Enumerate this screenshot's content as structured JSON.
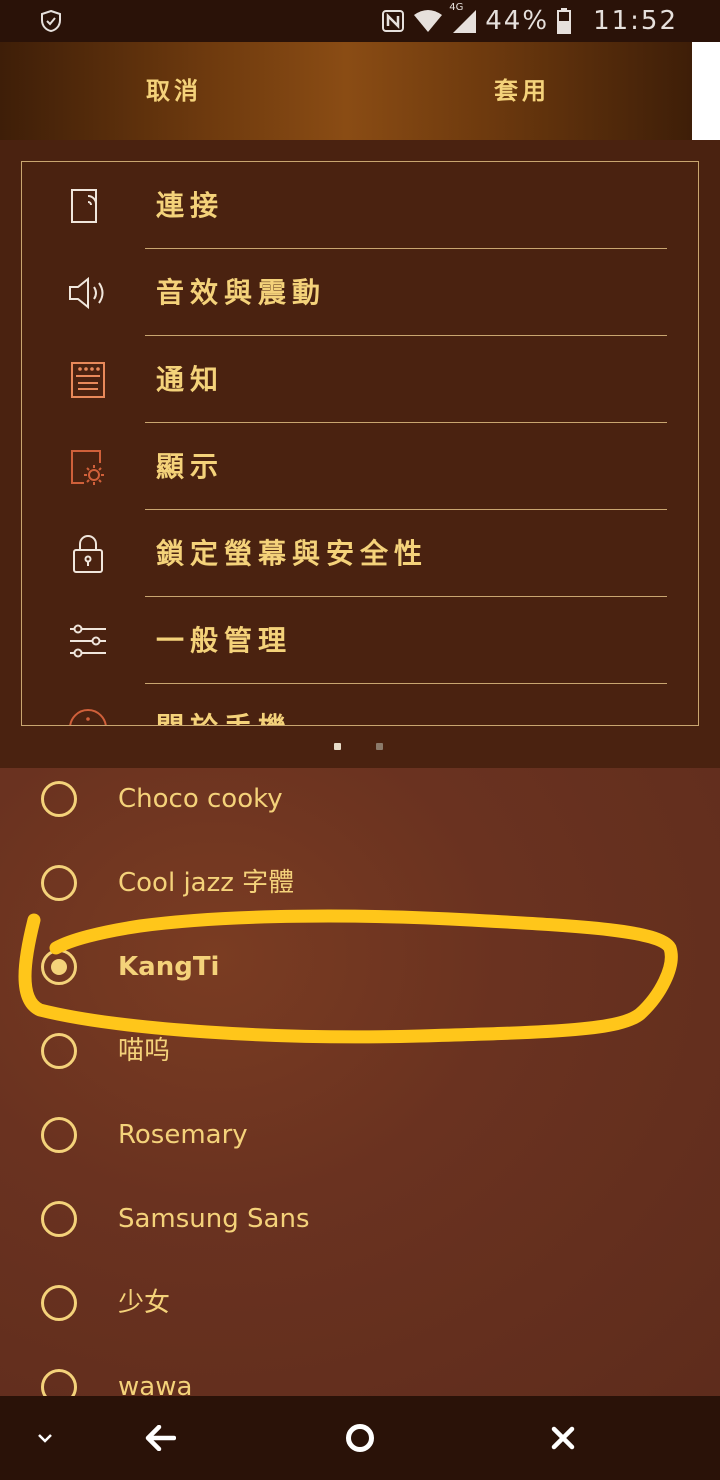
{
  "status_bar": {
    "battery": "44%",
    "time": "11:52",
    "network": "4G",
    "icons": [
      "shield-icon",
      "nfc-icon",
      "wifi-icon",
      "signal-icon",
      "battery-icon"
    ]
  },
  "action_bar": {
    "cancel_label": "取消",
    "apply_label": "套用"
  },
  "preview_menu": {
    "items": [
      {
        "label": "連接",
        "icon": "connections-icon"
      },
      {
        "label": "音效與震動",
        "icon": "speaker-icon"
      },
      {
        "label": "通知",
        "icon": "notifications-icon"
      },
      {
        "label": "顯示",
        "icon": "display-brightness-icon"
      },
      {
        "label": "鎖定螢幕與安全性",
        "icon": "lock-icon"
      },
      {
        "label": "一般管理",
        "icon": "sliders-icon"
      },
      {
        "label": "關於手機",
        "icon": "info-icon"
      }
    ]
  },
  "font_list": {
    "items": [
      {
        "label": "Choco cooky",
        "selected": false
      },
      {
        "label": "Cool jazz 字體",
        "selected": false
      },
      {
        "label": "KangTi",
        "selected": true
      },
      {
        "label": "喵呜",
        "selected": false
      },
      {
        "label": "Rosemary",
        "selected": false
      },
      {
        "label": "Samsung Sans",
        "selected": false
      },
      {
        "label": "少女",
        "selected": false
      },
      {
        "label": "wawa",
        "selected": false
      }
    ]
  },
  "colors": {
    "accent": "#f4d27a",
    "highlight_stroke": "#ffc61a",
    "panel": "#4a2210",
    "list_bg": "#6a3220"
  },
  "nav_bar": {
    "icons": [
      "chevron-down-icon",
      "back-arrow-icon",
      "home-circle-icon",
      "close-icon"
    ]
  }
}
